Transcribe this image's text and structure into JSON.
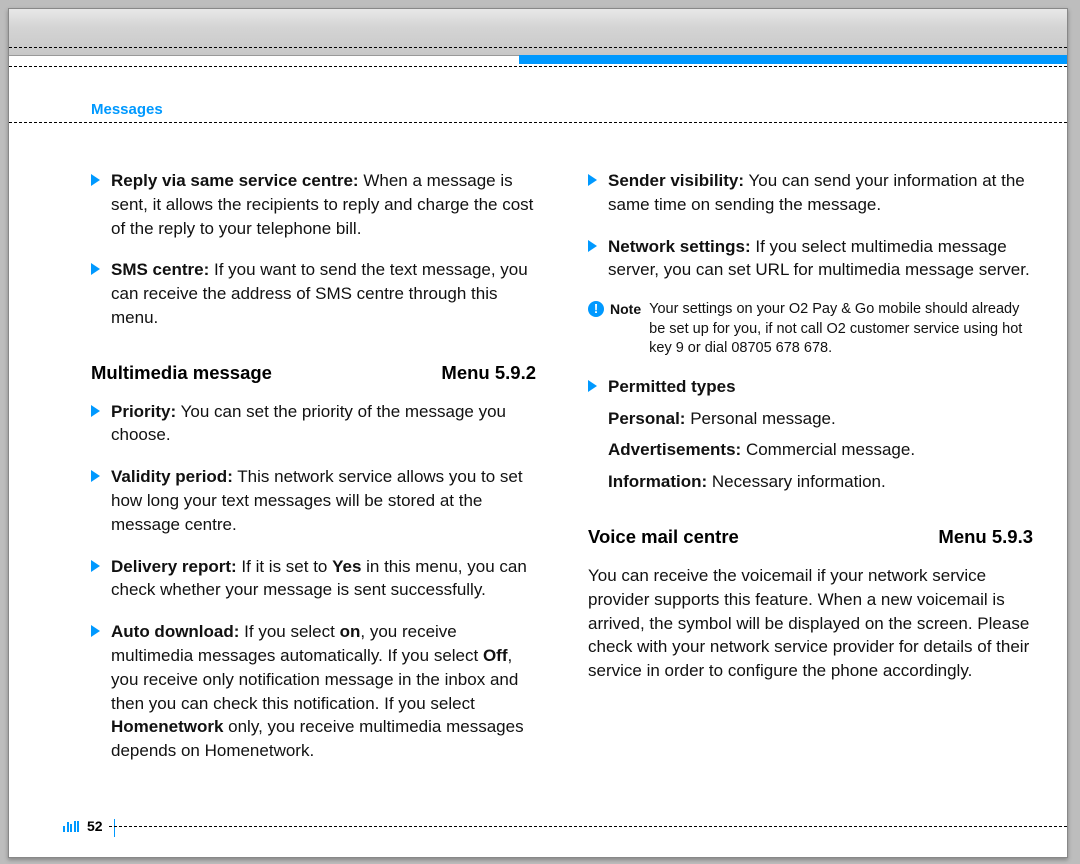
{
  "running_head": "Messages",
  "page_number": "52",
  "left": {
    "bullets_top": [
      {
        "title": "Reply via same service centre:",
        "text": " When a message is sent, it allows the recipients to reply and charge the cost of the reply to your telephone bill."
      },
      {
        "title": "SMS centre:",
        "text": " If you want to send the text message, you can receive the address of SMS centre through this menu."
      }
    ],
    "section1_title": "Multimedia message",
    "section1_menu": "Menu 5.9.2",
    "bullets_mm": [
      {
        "title": "Priority:",
        "text": " You can set the priority of the message you choose."
      },
      {
        "title": "Validity period:",
        "text": " This network service allows you to set how long your text messages will be stored at the message centre."
      },
      {
        "title": "Delivery report:",
        "pre": " If it is set to ",
        "bold1": "Yes",
        "post1": " in this menu, you can check whether your message is sent successfully."
      },
      {
        "title": "Auto download:",
        "pre": " If you select ",
        "bold1": "on",
        "mid": ", you receive multimedia messages automatically. If you select ",
        "bold2": "Off",
        "mid2": ", you receive only notification message in the inbox and then you can check this notification. If you select ",
        "bold3": "Homenetwork",
        "post": " only, you receive multimedia messages depends on Homenetwork."
      }
    ]
  },
  "right": {
    "bullets_top": [
      {
        "title": "Sender visibility:",
        "text": " You can send your information at the same time on sending the message."
      },
      {
        "title": "Network settings:",
        "text": " If you select multimedia message server, you can set URL for multimedia message server."
      }
    ],
    "note_label": "Note",
    "note_text": "Your settings on your O2 Pay & Go mobile should already be set up for you, if not call O2 customer service using hot key 9 or dial 08705 678 678.",
    "permitted_title": "Permitted types",
    "permitted": [
      {
        "label": "Personal:",
        "text": " Personal message."
      },
      {
        "label": "Advertisements:",
        "text": " Commercial message."
      },
      {
        "label": "Information:",
        "text": " Necessary information."
      }
    ],
    "section2_title": "Voice mail centre",
    "section2_menu": "Menu 5.9.3",
    "voicemail_para": "You can receive the voicemail if your network service provider supports this feature. When a new voicemail is arrived, the symbol will be displayed on the screen. Please check with your network service provider for details of their service in order to configure the phone accordingly."
  }
}
